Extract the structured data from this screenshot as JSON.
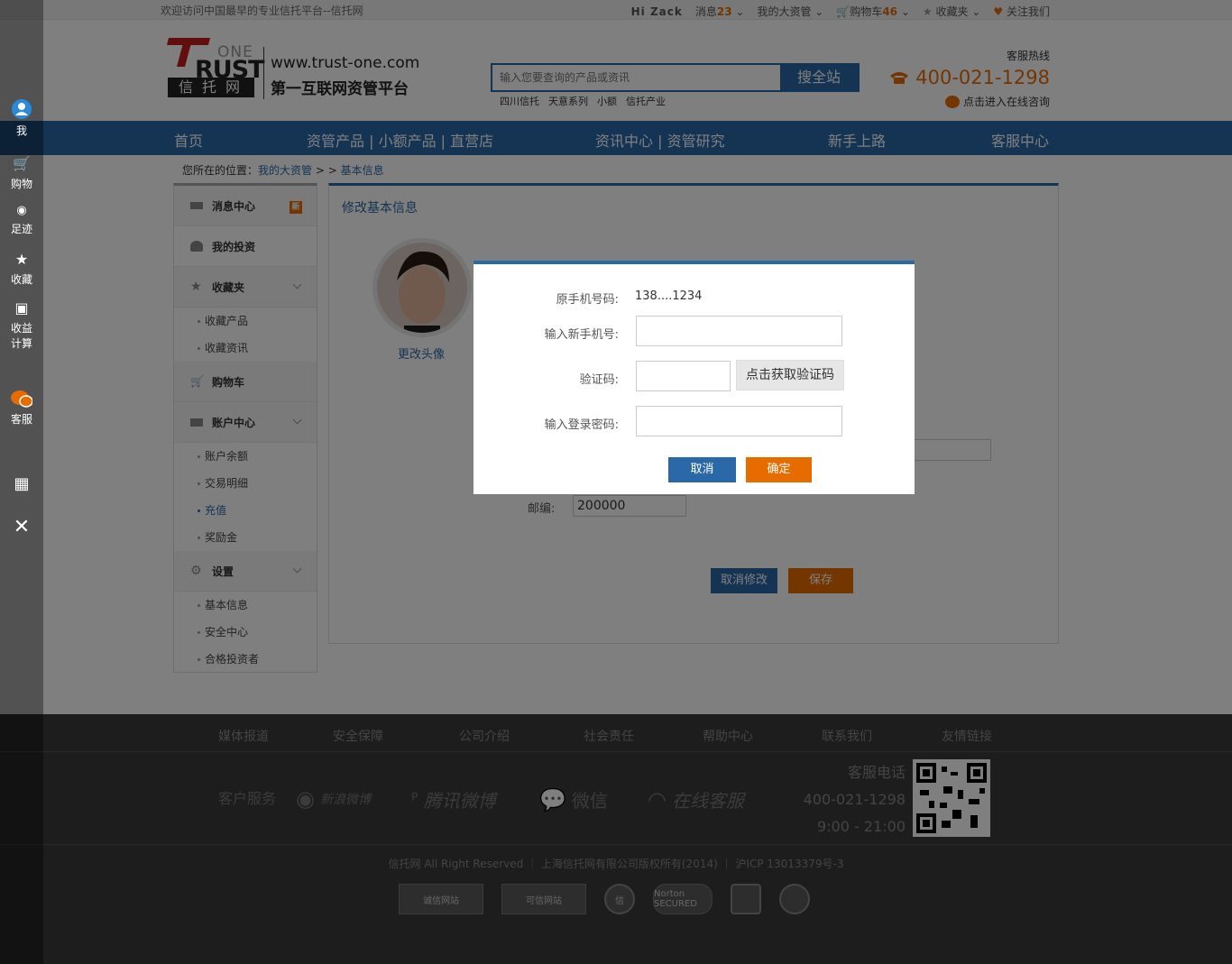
{
  "topbar": {
    "welcome": "欢迎访问中国最早的专业信托平台--信托网",
    "greeting": "Hi  Zack",
    "messages_label": "消息",
    "messages_count": "23",
    "my_asset": "我的大资管",
    "cart_label": "购物车",
    "cart_count": "46",
    "favorites": "收藏夹",
    "follow": "关注我们"
  },
  "header": {
    "logo_one": "ONE",
    "logo_trust": "RUST",
    "logo_cn": "信托网",
    "url": "www.trust-one.com",
    "slogan": "第一互联网资管平台",
    "search_placeholder": "输入您要查询的产品或资讯",
    "search_button": "搜全站",
    "hotwords": [
      "四川信托",
      "天意系列",
      "小额",
      "信托产业"
    ],
    "hotline_label": "客服热线",
    "hotline": "400-021-1298",
    "consult": "点击进入在线咨询"
  },
  "nav": {
    "items": [
      "首页",
      "资管产品 | 小额产品 | 直营店",
      "资讯中心 | 资管研究",
      "新手上路",
      "客服中心"
    ]
  },
  "breadcrumb": {
    "prefix": "您所在的位置：",
    "level1": "我的大资管",
    "sep": " > > ",
    "level2": "基本信息"
  },
  "sidebar": {
    "message_center": "消息中心",
    "new_badge": "新",
    "my_invest": "我的投资",
    "favorites": "收藏夹",
    "fav_products": "收藏产品",
    "fav_news": "收藏资讯",
    "cart": "购物车",
    "account_center": "账户中心",
    "balance": "账户余额",
    "transactions": "交易明细",
    "recharge": "充值",
    "bonus": "奖励金",
    "settings": "设置",
    "basic_info": "基本信息",
    "security": "安全中心",
    "qualified": "合格投资者"
  },
  "main": {
    "title": "修改基本信息",
    "change_avatar": "更改头像",
    "zip_label": "邮编:",
    "zip_value": "200000",
    "cancel_edit": "取消修改",
    "save": "保存"
  },
  "leftbar": {
    "me": "我",
    "shopping": "购物",
    "footprint": "足迹",
    "collect": "收藏",
    "calc_line1": "收益",
    "calc_line2": "计算",
    "service": "客服"
  },
  "modal": {
    "orig_phone_label": "原手机号码:",
    "orig_phone_value": "138....1234",
    "new_phone_label": "输入新手机号:",
    "code_label": "验证码:",
    "get_code_button": "点击获取验证码",
    "password_label": "输入登录密码:",
    "cancel": "取消",
    "confirm": "确定"
  },
  "footer": {
    "links": [
      "媒体报道",
      "安全保障",
      "公司介绍",
      "社会责任",
      "帮助中心",
      "联系我们",
      "友情链接"
    ],
    "customer_service": "客户服务",
    "weibo_sina": "新浪微博",
    "weibo_tencent": "腾讯微博",
    "wechat": "微信",
    "online_service": "在线客服",
    "phone_label": "客服电话",
    "phone": "400-021-1298",
    "hours": "9:00 - 21:00",
    "copyright": "信托网 All Right Reserved  ｜ 上海信托网有限公司版权所有(2014)  ｜  沪ICP 13013379号-3",
    "badge_1": "诚信网站",
    "badge_2": "可信网站",
    "badge_3": "信",
    "badge_4": "Norton SECURED"
  },
  "colors": {
    "brand_blue": "#2a68a8",
    "accent_orange": "#e76c00",
    "logo_red": "#c41d1d"
  }
}
